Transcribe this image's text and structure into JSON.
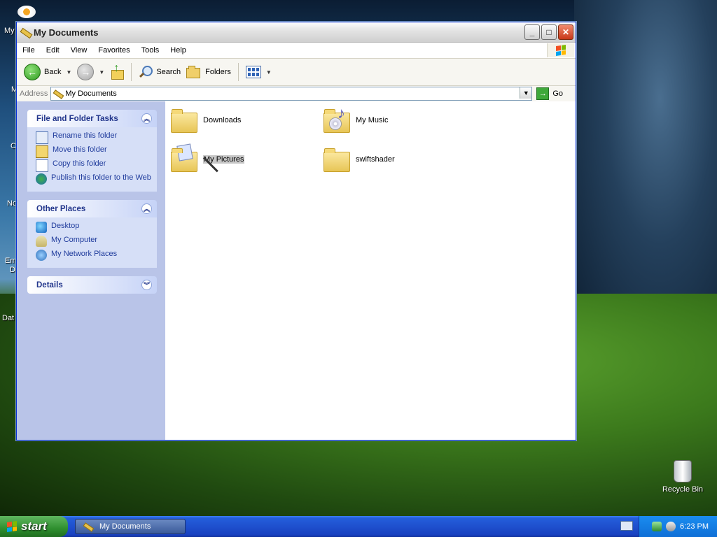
{
  "desktop": {
    "left_labels": [
      "My",
      "M",
      "C",
      "No",
      "Em",
      "D",
      "Dat"
    ],
    "recycle_bin_label": "Recycle Bin"
  },
  "window": {
    "title": "My Documents",
    "menu": [
      "File",
      "Edit",
      "View",
      "Favorites",
      "Tools",
      "Help"
    ],
    "toolbar": {
      "back": "Back",
      "search": "Search",
      "folders": "Folders"
    },
    "address": {
      "label": "Address",
      "value": "My Documents",
      "go": "Go"
    },
    "panels": {
      "tasks": {
        "title": "File and Folder Tasks",
        "items": [
          "Rename this folder",
          "Move this folder",
          "Copy this folder",
          "Publish this folder to the Web"
        ]
      },
      "other": {
        "title": "Other Places",
        "items": [
          "Desktop",
          "My Computer",
          "My Network Places"
        ]
      },
      "details": {
        "title": "Details"
      }
    },
    "files": [
      "Downloads",
      "My Music",
      "My Pictures",
      "swiftshader"
    ]
  },
  "taskbar": {
    "start": "start",
    "active_task": "My Documents",
    "clock": "6:23 PM"
  }
}
